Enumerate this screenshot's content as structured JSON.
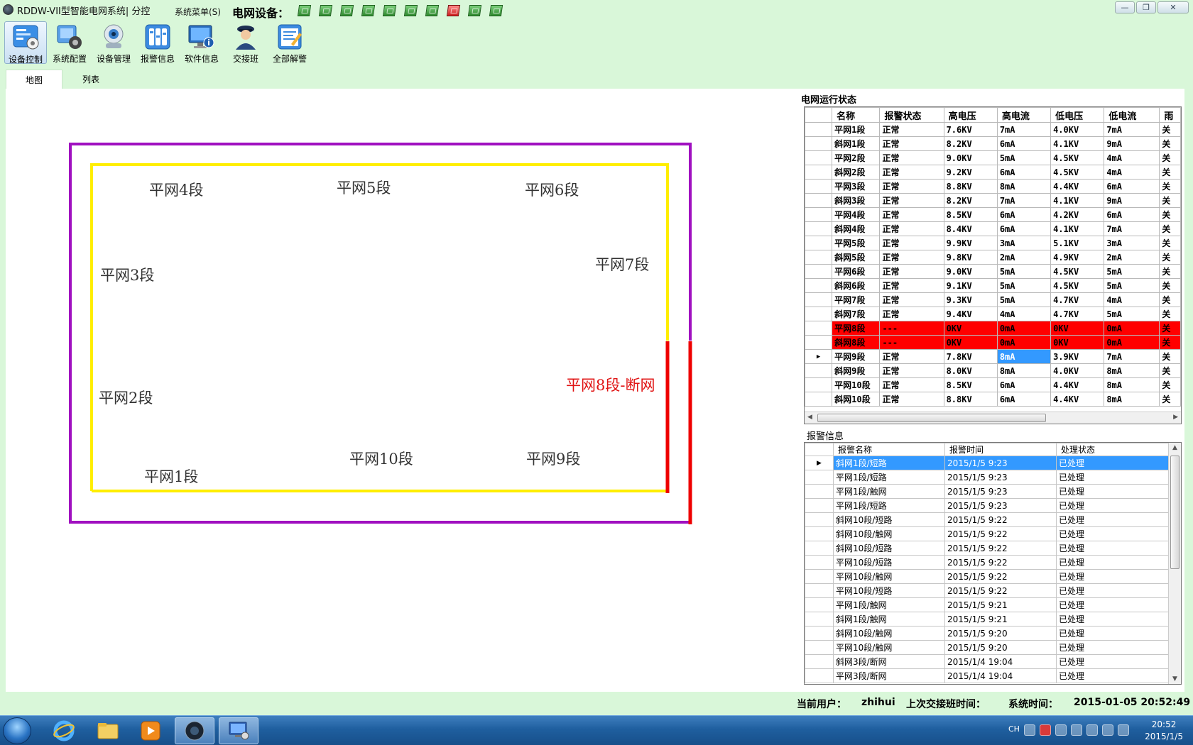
{
  "title_bar": {
    "app_title": "RDDW-VII型智能电网系统| 分控",
    "system_menu": "系统菜单(S)",
    "grid_devices_label": "电网设备：",
    "devices": [
      "ok",
      "ok",
      "ok",
      "ok",
      "ok",
      "ok",
      "ok",
      "alarm",
      "ok",
      "ok"
    ]
  },
  "toolbar": {
    "items": [
      {
        "label": "设备控制",
        "icon": "device-control-icon"
      },
      {
        "label": "系统配置",
        "icon": "system-config-icon"
      },
      {
        "label": "设备管理",
        "icon": "device-manage-icon"
      },
      {
        "label": "报警信息",
        "icon": "alarm-info-icon"
      },
      {
        "label": "软件信息",
        "icon": "software-info-icon"
      },
      {
        "label": "交接班",
        "icon": "shift-handover-icon"
      },
      {
        "label": "全部解警",
        "icon": "clear-alarms-icon"
      }
    ]
  },
  "tabs": [
    {
      "label": "地图",
      "active": true
    },
    {
      "label": "列表",
      "active": false
    }
  ],
  "map": {
    "labels": {
      "seg1": "平网1段",
      "seg2": "平网2段",
      "seg3": "平网3段",
      "seg4": "平网4段",
      "seg5": "平网5段",
      "seg6": "平网6段",
      "seg7": "平网7段",
      "seg8": "平网8段-断网",
      "seg9": "平网9段",
      "seg10": "平网10段"
    },
    "colors": {
      "outer": "#a010c0",
      "inner": "#ffee00",
      "broken": "#ee0000"
    }
  },
  "grid_status": {
    "title": "电网运行状态",
    "columns": [
      "名称",
      "报警状态",
      "高电压",
      "高电流",
      "低电压",
      "低电流",
      "雨"
    ],
    "rows": [
      [
        "平网1段",
        "正常",
        "7.6KV",
        "7mA",
        "4.0KV",
        "7mA",
        "关"
      ],
      [
        "斜网1段",
        "正常",
        "8.2KV",
        "6mA",
        "4.1KV",
        "9mA",
        "关"
      ],
      [
        "平网2段",
        "正常",
        "9.0KV",
        "5mA",
        "4.5KV",
        "4mA",
        "关"
      ],
      [
        "斜网2段",
        "正常",
        "9.2KV",
        "6mA",
        "4.5KV",
        "4mA",
        "关"
      ],
      [
        "平网3段",
        "正常",
        "8.8KV",
        "8mA",
        "4.4KV",
        "6mA",
        "关"
      ],
      [
        "斜网3段",
        "正常",
        "8.2KV",
        "7mA",
        "4.1KV",
        "9mA",
        "关"
      ],
      [
        "平网4段",
        "正常",
        "8.5KV",
        "6mA",
        "4.2KV",
        "6mA",
        "关"
      ],
      [
        "斜网4段",
        "正常",
        "8.4KV",
        "6mA",
        "4.1KV",
        "7mA",
        "关"
      ],
      [
        "平网5段",
        "正常",
        "9.9KV",
        "3mA",
        "5.1KV",
        "3mA",
        "关"
      ],
      [
        "斜网5段",
        "正常",
        "9.8KV",
        "2mA",
        "4.9KV",
        "2mA",
        "关"
      ],
      [
        "平网6段",
        "正常",
        "9.0KV",
        "5mA",
        "4.5KV",
        "5mA",
        "关"
      ],
      [
        "斜网6段",
        "正常",
        "9.1KV",
        "5mA",
        "4.5KV",
        "5mA",
        "关"
      ],
      [
        "平网7段",
        "正常",
        "9.3KV",
        "5mA",
        "4.7KV",
        "4mA",
        "关"
      ],
      [
        "斜网7段",
        "正常",
        "9.4KV",
        "4mA",
        "4.7KV",
        "5mA",
        "关"
      ],
      [
        "平网8段",
        "---",
        "0KV",
        "0mA",
        "0KV",
        "0mA",
        "关"
      ],
      [
        "斜网8段",
        "---",
        "0KV",
        "0mA",
        "0KV",
        "0mA",
        "关"
      ],
      [
        "平网9段",
        "正常",
        "7.8KV",
        "8mA",
        "3.9KV",
        "7mA",
        "关"
      ],
      [
        "斜网9段",
        "正常",
        "8.0KV",
        "8mA",
        "4.0KV",
        "8mA",
        "关"
      ],
      [
        "平网10段",
        "正常",
        "8.5KV",
        "6mA",
        "4.4KV",
        "8mA",
        "关"
      ],
      [
        "斜网10段",
        "正常",
        "8.8KV",
        "6mA",
        "4.4KV",
        "8mA",
        "关"
      ]
    ],
    "alarm_rows": [
      14,
      15
    ],
    "current_row": 16,
    "selected_cell": [
      16,
      3
    ],
    "colors": {
      "alarm_bg": "#ff0000",
      "selection": "#3399ff"
    }
  },
  "alarm_info": {
    "title": "报警信息",
    "columns": [
      "报警名称",
      "报警时间",
      "处理状态"
    ],
    "rows": [
      [
        "斜网1段/短路",
        "2015/1/5 9:23",
        "已处理"
      ],
      [
        "平网1段/短路",
        "2015/1/5 9:23",
        "已处理"
      ],
      [
        "平网1段/触网",
        "2015/1/5 9:23",
        "已处理"
      ],
      [
        "平网1段/短路",
        "2015/1/5 9:23",
        "已处理"
      ],
      [
        "斜网10段/短路",
        "2015/1/5 9:22",
        "已处理"
      ],
      [
        "斜网10段/触网",
        "2015/1/5 9:22",
        "已处理"
      ],
      [
        "斜网10段/短路",
        "2015/1/5 9:22",
        "已处理"
      ],
      [
        "平网10段/短路",
        "2015/1/5 9:22",
        "已处理"
      ],
      [
        "平网10段/触网",
        "2015/1/5 9:22",
        "已处理"
      ],
      [
        "平网10段/短路",
        "2015/1/5 9:22",
        "已处理"
      ],
      [
        "平网1段/触网",
        "2015/1/5 9:21",
        "已处理"
      ],
      [
        "斜网1段/触网",
        "2015/1/5 9:21",
        "已处理"
      ],
      [
        "斜网10段/触网",
        "2015/1/5 9:20",
        "已处理"
      ],
      [
        "平网10段/触网",
        "2015/1/5 9:20",
        "已处理"
      ],
      [
        "斜网3段/断网",
        "2015/1/4 19:04",
        "已处理"
      ],
      [
        "平网3段/断网",
        "2015/1/4 19:04",
        "已处理"
      ]
    ],
    "selected_row": 0
  },
  "status_bar": {
    "user_label": "当前用户：",
    "user": "zhihui",
    "last_shift_label": "上次交接班时间：",
    "last_shift": "",
    "system_time_label": "系统时间：",
    "system_time": "2015-01-05 20:52:49"
  },
  "taskbar": {
    "apps": [
      "windows-start-icon",
      "internet-explorer-icon",
      "file-explorer-icon",
      "media-player-icon",
      "grid-app-icon",
      "remote-desktop-icon"
    ],
    "tray_lang": "CH",
    "clock_time": "20:52",
    "clock_date": "2015/1/5"
  }
}
